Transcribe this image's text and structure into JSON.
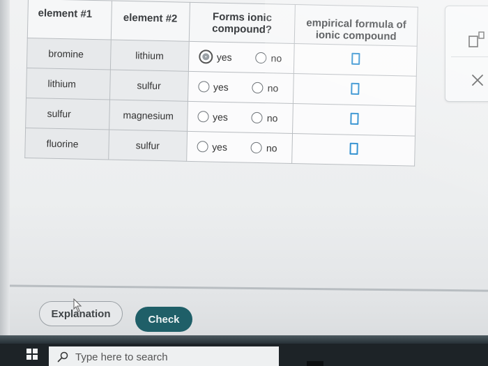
{
  "table": {
    "headers": {
      "element1": "element #1",
      "element2": "element #2",
      "forms_ionic": "Forms ionic compound?",
      "empirical": "empirical formula of ionic compound"
    },
    "rows": [
      {
        "element1": "bromine",
        "element2": "lithium",
        "yes_label": "yes",
        "no_label": "no",
        "selected": "yes"
      },
      {
        "element1": "lithium",
        "element2": "sulfur",
        "yes_label": "yes",
        "no_label": "no",
        "selected": ""
      },
      {
        "element1": "sulfur",
        "element2": "magnesium",
        "yes_label": "yes",
        "no_label": "no",
        "selected": ""
      },
      {
        "element1": "fluorine",
        "element2": "sulfur",
        "yes_label": "yes",
        "no_label": "no",
        "selected": ""
      }
    ]
  },
  "buttons": {
    "explanation": "Explanation",
    "check": "Check"
  },
  "taskbar": {
    "search_placeholder": "Type here to search"
  },
  "colors": {
    "check_button": "#1f5f68",
    "formula_box_border": "#2f8fd0",
    "taskbar": "#1d2327"
  },
  "icons": {
    "side_panel_top": "superscript-icon",
    "side_panel_bottom": "close-icon",
    "taskbar_start": "windows-start-icon",
    "taskbar_search": "search-icon"
  }
}
